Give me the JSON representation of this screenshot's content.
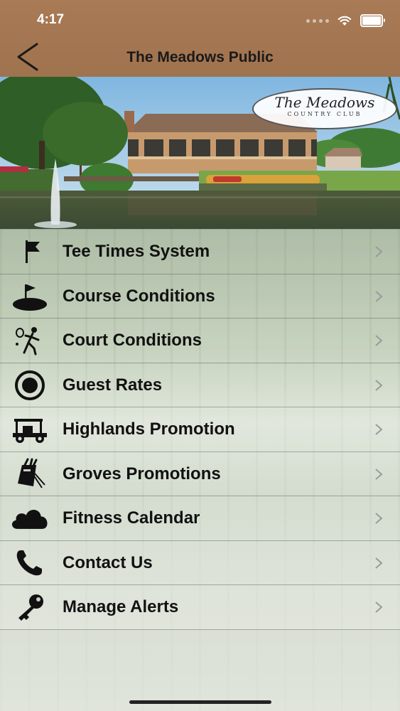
{
  "status_bar": {
    "time": "4:17"
  },
  "nav": {
    "title": "The Meadows Public",
    "back_icon": "chevron-left-icon"
  },
  "hero": {
    "logo_main": "The Meadows",
    "logo_sub": "COUNTRY CLUB"
  },
  "menu": {
    "items": [
      {
        "label": "Tee Times System",
        "icon": "flag-icon"
      },
      {
        "label": "Course Conditions",
        "icon": "golf-green-icon"
      },
      {
        "label": "Court Conditions",
        "icon": "tennis-player-icon"
      },
      {
        "label": "Guest Rates",
        "icon": "target-icon"
      },
      {
        "label": "Highlands Promotion",
        "icon": "golf-cart-icon"
      },
      {
        "label": "Groves Promotions",
        "icon": "golf-bag-icon"
      },
      {
        "label": "Fitness Calendar",
        "icon": "cloud-icon"
      },
      {
        "label": "Contact Us",
        "icon": "phone-icon"
      },
      {
        "label": "Manage Alerts",
        "icon": "key-icon"
      }
    ]
  },
  "colors": {
    "nav_bar": "#a87a55",
    "text": "#111111"
  }
}
